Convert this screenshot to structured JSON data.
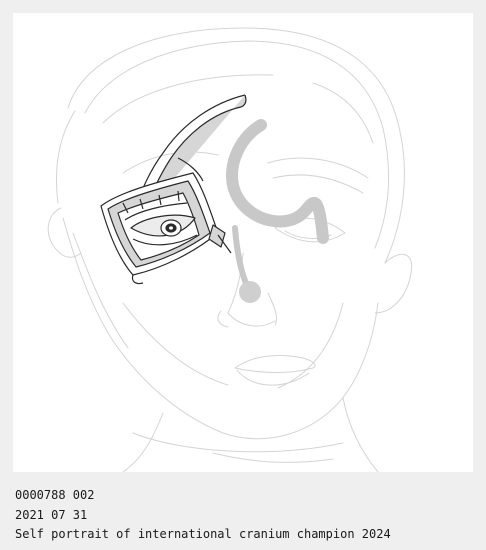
{
  "caption": {
    "id_line": "0000788 002",
    "date_line": "2021 07 31",
    "title_line": "Self portrait of international cranium champion 2024"
  },
  "artwork": {
    "subject": "line drawing of a face with a mechanical eye device",
    "colors": {
      "paper": "#ffffff",
      "matte": "#efefef",
      "faint_line": "#d4d4d4",
      "dark_line": "#2a2a2a",
      "shade": "#c8c8c8",
      "fill_gray": "#d6d6d6"
    }
  }
}
